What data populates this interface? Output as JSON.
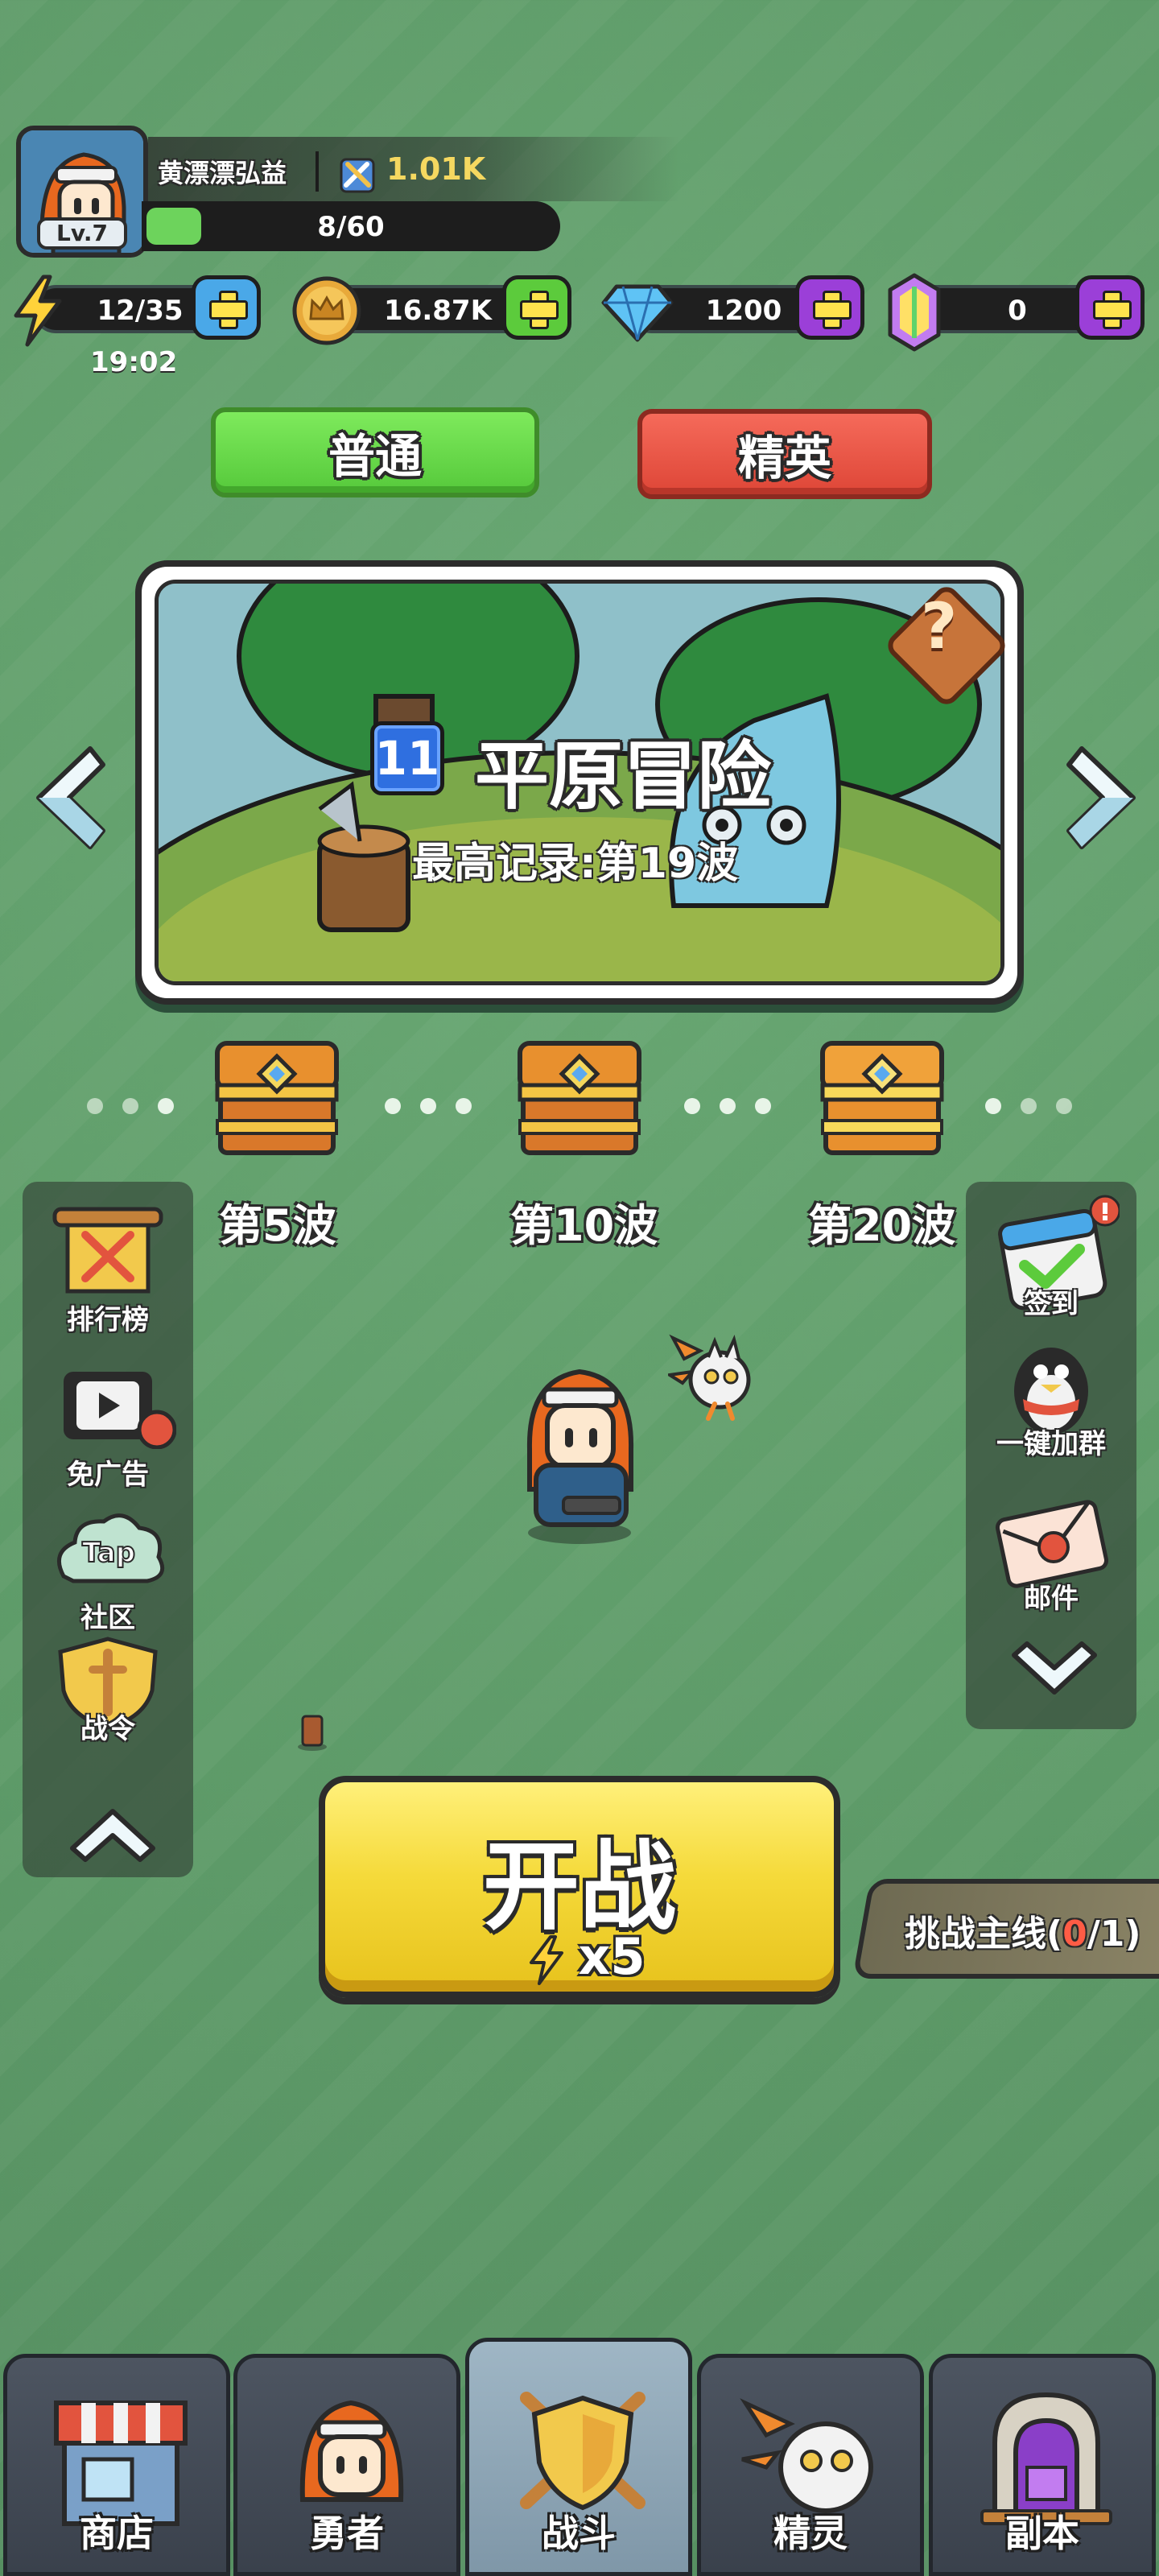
{
  "player": {
    "name": "黄漂漂弘益",
    "level": "Lv.7",
    "power": "1.01K",
    "exp_text": "8/60",
    "exp_fraction": 0.1333
  },
  "resources": {
    "energy": "12/35",
    "energy_timer": "19:02",
    "gold": "16.87K",
    "diamonds": "1200",
    "gems": "0"
  },
  "modes": {
    "normal": "普通",
    "elite": "精英"
  },
  "stage": {
    "number": "11",
    "title": "平原冒险",
    "record": "最高记录:第19波",
    "help_symbol": "?"
  },
  "waves": [
    {
      "label": "第5波"
    },
    {
      "label": "第10波"
    },
    {
      "label": "第20波"
    }
  ],
  "left_menu": {
    "rankings": "排行榜",
    "no_ads": "免广告",
    "community_logo": "Tap",
    "community": "社区",
    "battle_pass": "战令"
  },
  "right_menu": {
    "sign_in": "签到",
    "join_group": "一键加群",
    "mail": "邮件"
  },
  "start": {
    "title": "开战",
    "cost": "x5"
  },
  "challenge": {
    "label_prefix": "挑战主线(",
    "current": "0",
    "label_suffix": "/1)"
  },
  "bottom_nav": {
    "shop": "商店",
    "hero": "勇者",
    "battle": "战斗",
    "spirit": "精灵",
    "dungeon": "副本"
  },
  "colors": {
    "background": "#5f9c6a",
    "normal_mode": "#56c93b",
    "elite_mode": "#de4637",
    "start_button": "#f5da3a",
    "challenge_highlight": "#ff5c45",
    "plus_blue": "#4aa8e8",
    "plus_green": "#5ccb3c",
    "plus_purple": "#9b3fd8"
  }
}
